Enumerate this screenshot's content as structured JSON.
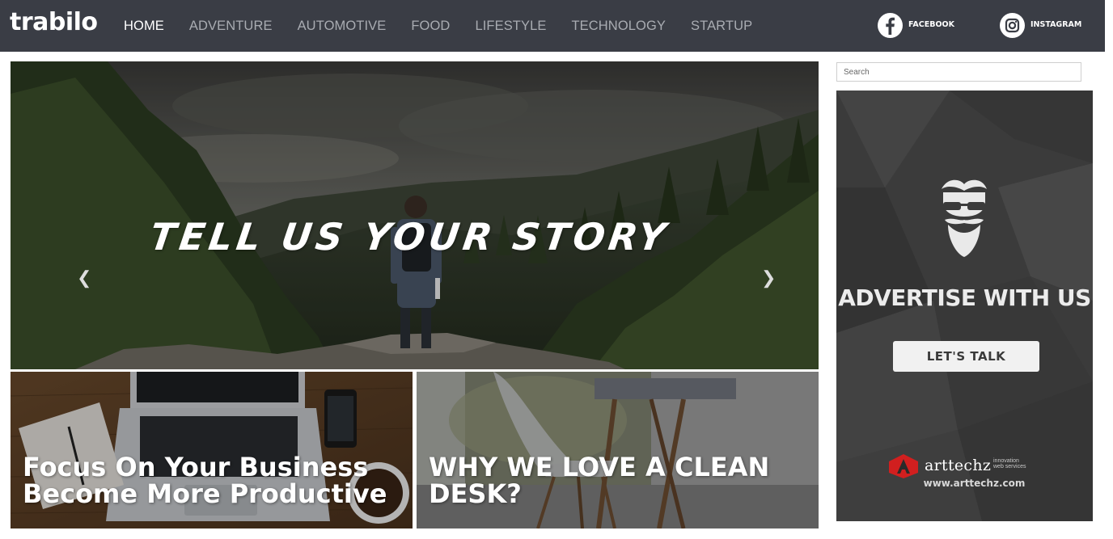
{
  "header": {
    "logo": "trabilo",
    "nav": [
      "HOME",
      "ADVENTURE",
      "AUTOMOTIVE",
      "FOOD",
      "LIFESTYLE",
      "TECHNOLOGY",
      "STARTUP"
    ],
    "active_nav": "HOME",
    "social": [
      {
        "label": "FACEBOOK",
        "icon": "facebook-icon"
      },
      {
        "label": "INSTAGRAM",
        "icon": "instagram-icon"
      }
    ]
  },
  "hero": {
    "title": "TELL US YOUR STORY",
    "prev_icon": "chevron-left-icon",
    "next_icon": "chevron-right-icon"
  },
  "cards": [
    {
      "line1": "Focus On Your Business",
      "line2": "Become More Productive"
    },
    {
      "line1": "WHY WE LOVE A CLEAN",
      "line2": "DESK?"
    }
  ],
  "sidebar": {
    "search_placeholder": "Search",
    "ad": {
      "heading": "ADVERTISE WITH US",
      "button": "LET'S TALK",
      "brand_name": "arttechz",
      "brand_tag_line1": "innovation",
      "brand_tag_line2": "web services",
      "url": "www.arttechz.com"
    }
  },
  "colors": {
    "header_bg": "#3a3d45",
    "nav_text": "#a9acb2",
    "nav_active": "#ffffff",
    "ad_bg": "#3b3b3b",
    "brand_red": "#d11f1f"
  }
}
